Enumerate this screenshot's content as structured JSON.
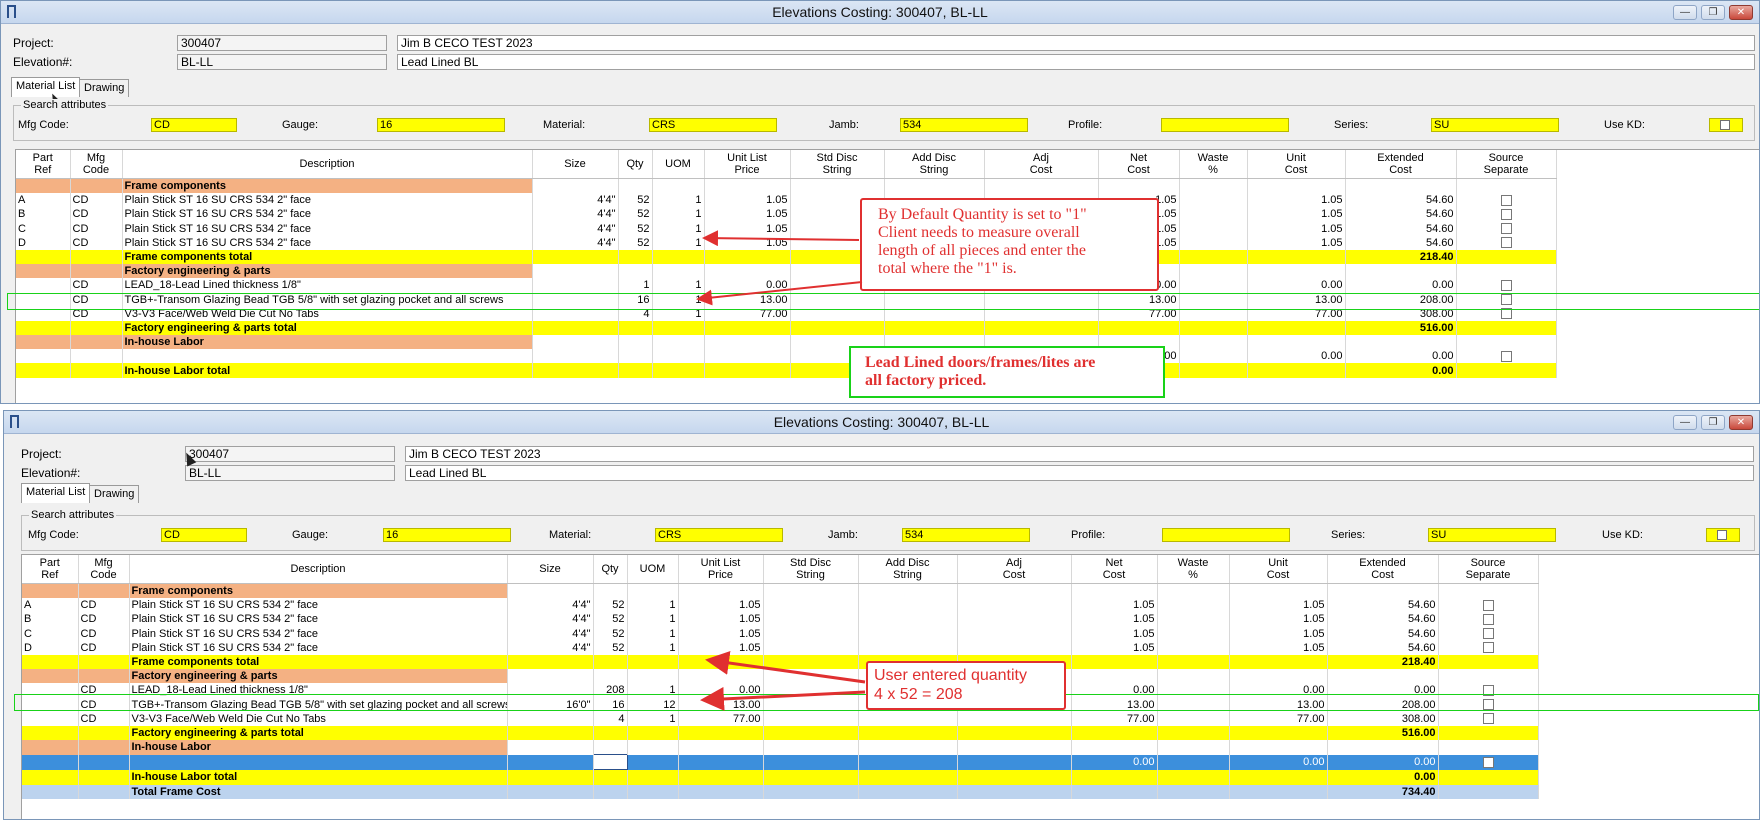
{
  "colors": {
    "section": "#f4b183",
    "total": "#ffff00",
    "selected": "#3c8fdc",
    "callout": "#e03030",
    "highlight": "#19d219"
  },
  "win1": {
    "title": "Elevations Costing: 300407, BL-LL",
    "project_label": "Project:",
    "project_value": "300407",
    "project_name": "Jim B CECO TEST 2023",
    "elevation_label": "Elevation#:",
    "elevation_value": "BL-LL",
    "elevation_name": "Lead Lined BL",
    "tabs": [
      "Material List",
      "Drawing"
    ],
    "search_group": "Search attributes",
    "attrs": {
      "mfg_label": "Mfg Code:",
      "mfg": "CD",
      "gauge_label": "Gauge:",
      "gauge": "16",
      "material_label": "Material:",
      "material": "CRS",
      "jamb_label": "Jamb:",
      "jamb": "534",
      "profile_label": "Profile:",
      "profile": "",
      "series_label": "Series:",
      "series": "SU",
      "usekd_label": "Use KD:"
    },
    "headers": [
      [
        "Part",
        "Ref"
      ],
      [
        "Mfg",
        "Code"
      ],
      [
        "",
        "Description"
      ],
      [
        "",
        "Size"
      ],
      [
        "",
        "Qty"
      ],
      [
        "",
        "UOM"
      ],
      [
        "Unit List",
        "Price"
      ],
      [
        "Std Disc",
        "String"
      ],
      [
        "Add Disc",
        "String"
      ],
      [
        "Adj",
        "Cost"
      ],
      [
        "Net",
        "Cost"
      ],
      [
        "Waste",
        "%"
      ],
      [
        "Unit",
        "Cost"
      ],
      [
        "Extended",
        "Cost"
      ],
      [
        "Source",
        "Separate"
      ]
    ],
    "rows": [
      {
        "type": "section",
        "desc": "Frame components"
      },
      {
        "type": "item",
        "ref": "A",
        "mfg": "CD",
        "desc": "Plain Stick ST 16 SU CRS   534 2\"  face",
        "size": "4'4\"",
        "qty": "52",
        "uom": "1",
        "ulp": "1.05",
        "net": "1.05",
        "unit": "1.05",
        "ext": "54.60"
      },
      {
        "type": "item",
        "ref": "B",
        "mfg": "CD",
        "desc": "Plain Stick ST 16 SU CRS   534 2\"  face",
        "size": "4'4\"",
        "qty": "52",
        "uom": "1",
        "ulp": "1.05",
        "net": "1.05",
        "unit": "1.05",
        "ext": "54.60"
      },
      {
        "type": "item",
        "ref": "C",
        "mfg": "CD",
        "desc": "Plain Stick ST 16 SU CRS   534 2\"  face",
        "size": "4'4\"",
        "qty": "52",
        "uom": "1",
        "ulp": "1.05",
        "net": "1.05",
        "unit": "1.05",
        "ext": "54.60"
      },
      {
        "type": "item",
        "ref": "D",
        "mfg": "CD",
        "desc": "Plain Stick ST 16 SU CRS   534 2\"  face",
        "size": "4'4\"",
        "qty": "52",
        "uom": "1",
        "ulp": "1.05",
        "net": "1.05",
        "unit": "1.05",
        "ext": "54.60"
      },
      {
        "type": "total",
        "desc": "Frame components total",
        "ext": "218.40"
      },
      {
        "type": "section",
        "desc": "Factory engineering & parts"
      },
      {
        "type": "item",
        "ref": "",
        "mfg": "CD",
        "desc": "LEAD_18-Lead Lined thickness 1/8\"",
        "size": "",
        "qty": "1",
        "uom": "1",
        "ulp": "0.00",
        "net": "0.00",
        "unit": "0.00",
        "ext": "0.00"
      },
      {
        "type": "item",
        "ref": "",
        "mfg": "CD",
        "desc": "TGB+-Transom Glazing Bead TGB 5/8\" with set glazing pocket and all screws",
        "size": "",
        "qty": "16",
        "uom": "1",
        "ulp": "13.00",
        "net": "13.00",
        "unit": "13.00",
        "ext": "208.00"
      },
      {
        "type": "item",
        "ref": "",
        "mfg": "CD",
        "desc": "V3-V3 Face/Web Weld Die Cut No Tabs",
        "size": "",
        "qty": "4",
        "uom": "1",
        "ulp": "77.00",
        "net": "77.00",
        "unit": "77.00",
        "ext": "308.00"
      },
      {
        "type": "total",
        "desc": "Factory engineering & parts total",
        "ext": "516.00"
      },
      {
        "type": "section",
        "desc": "In-house Labor"
      },
      {
        "type": "item",
        "ref": "",
        "mfg": "",
        "desc": "",
        "size": "",
        "qty": "",
        "uom": "",
        "ulp": "",
        "net": "0.00",
        "unit": "0.00",
        "ext": "0.00"
      },
      {
        "type": "total",
        "desc": "In-house Labor total",
        "ext": "0.00"
      }
    ],
    "callout": [
      "By Default Quantity is set to \"1\"",
      "Client needs to measure overall",
      "length of all pieces and enter the",
      "total where the \"1\" is."
    ],
    "note": [
      "Lead Lined doors/frames/lites are",
      "all factory priced."
    ]
  },
  "win2": {
    "title": "Elevations Costing: 300407, BL-LL",
    "project_label": "Project:",
    "project_value": "300407",
    "project_name": "Jim B CECO TEST 2023",
    "elevation_label": "Elevation#:",
    "elevation_value": "BL-LL",
    "elevation_name": "Lead Lined BL",
    "tabs": [
      "Material List",
      "Drawing"
    ],
    "search_group": "Search attributes",
    "attrs": {
      "mfg_label": "Mfg Code:",
      "mfg": "CD",
      "gauge_label": "Gauge:",
      "gauge": "16",
      "material_label": "Material:",
      "material": "CRS",
      "jamb_label": "Jamb:",
      "jamb": "534",
      "profile_label": "Profile:",
      "profile": "",
      "series_label": "Series:",
      "series": "SU",
      "usekd_label": "Use KD:"
    },
    "headers": [
      [
        "Part",
        "Ref"
      ],
      [
        "Mfg",
        "Code"
      ],
      [
        "",
        "Description"
      ],
      [
        "",
        "Size"
      ],
      [
        "",
        "Qty"
      ],
      [
        "",
        "UOM"
      ],
      [
        "Unit List",
        "Price"
      ],
      [
        "Std Disc",
        "String"
      ],
      [
        "Add Disc",
        "String"
      ],
      [
        "Adj",
        "Cost"
      ],
      [
        "Net",
        "Cost"
      ],
      [
        "Waste",
        "%"
      ],
      [
        "Unit",
        "Cost"
      ],
      [
        "Extended",
        "Cost"
      ],
      [
        "Source",
        "Separate"
      ]
    ],
    "rows": [
      {
        "type": "section",
        "desc": "Frame components"
      },
      {
        "type": "item",
        "ref": "A",
        "mfg": "CD",
        "desc": "Plain Stick ST 16 SU CRS   534 2\"  face",
        "size": "4'4\"",
        "qty": "52",
        "uom": "1",
        "ulp": "1.05",
        "net": "1.05",
        "unit": "1.05",
        "ext": "54.60"
      },
      {
        "type": "item",
        "ref": "B",
        "mfg": "CD",
        "desc": "Plain Stick ST 16 SU CRS   534 2\"  face",
        "size": "4'4\"",
        "qty": "52",
        "uom": "1",
        "ulp": "1.05",
        "net": "1.05",
        "unit": "1.05",
        "ext": "54.60"
      },
      {
        "type": "item",
        "ref": "C",
        "mfg": "CD",
        "desc": "Plain Stick ST 16 SU CRS   534 2\"  face",
        "size": "4'4\"",
        "qty": "52",
        "uom": "1",
        "ulp": "1.05",
        "net": "1.05",
        "unit": "1.05",
        "ext": "54.60"
      },
      {
        "type": "item",
        "ref": "D",
        "mfg": "CD",
        "desc": "Plain Stick ST 16 SU CRS   534 2\"  face",
        "size": "4'4\"",
        "qty": "52",
        "uom": "1",
        "ulp": "1.05",
        "net": "1.05",
        "unit": "1.05",
        "ext": "54.60"
      },
      {
        "type": "total",
        "desc": "Frame components total",
        "ext": "218.40"
      },
      {
        "type": "section",
        "desc": "Factory engineering & parts"
      },
      {
        "type": "item",
        "ref": "",
        "mfg": "CD",
        "desc": "LEAD_18-Lead Lined thickness 1/8\"",
        "size": "",
        "qty": "208",
        "uom": "1",
        "ulp": "0.00",
        "net": "0.00",
        "unit": "0.00",
        "ext": "0.00"
      },
      {
        "type": "item",
        "ref": "",
        "mfg": "CD",
        "desc": "TGB+-Transom Glazing Bead TGB 5/8\" with set glazing pocket and all screws",
        "size": "16'0\"",
        "qty": "16",
        "uom": "12",
        "ulp": "13.00",
        "net": "13.00",
        "unit": "13.00",
        "ext": "208.00"
      },
      {
        "type": "item",
        "ref": "",
        "mfg": "CD",
        "desc": "V3-V3 Face/Web Weld Die Cut No Tabs",
        "size": "",
        "qty": "4",
        "uom": "1",
        "ulp": "77.00",
        "net": "77.00",
        "unit": "77.00",
        "ext": "308.00"
      },
      {
        "type": "total",
        "desc": "Factory engineering & parts total",
        "ext": "516.00"
      },
      {
        "type": "section",
        "desc": "In-house Labor"
      },
      {
        "type": "selected",
        "ref": "",
        "mfg": "",
        "desc": "",
        "size": "",
        "qty": "",
        "uom": "",
        "ulp": "",
        "net": "0.00",
        "unit": "0.00",
        "ext": "0.00"
      },
      {
        "type": "total",
        "desc": "In-house Labor total",
        "ext": "0.00"
      },
      {
        "type": "grand",
        "desc": "Total Frame Cost",
        "ext": "734.40"
      }
    ],
    "callout": [
      "User entered quantity",
      "4 x 52 = 208"
    ]
  }
}
